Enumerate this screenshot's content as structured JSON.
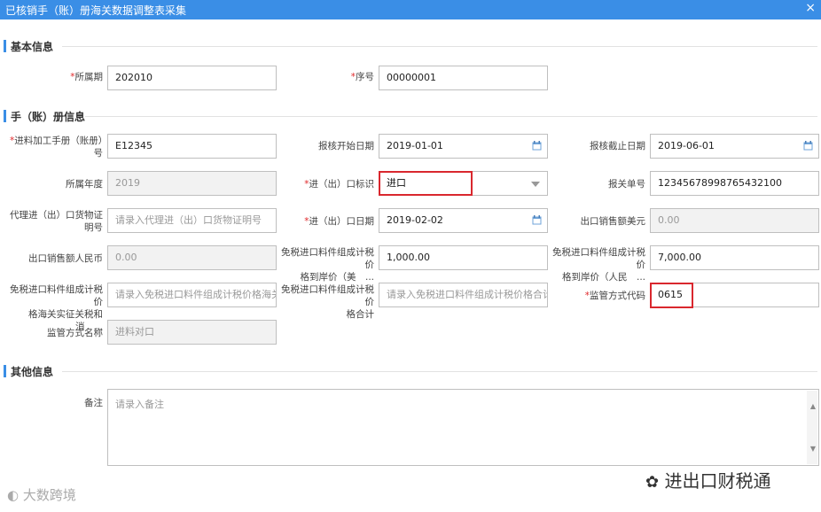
{
  "window": {
    "title": "已核销手（账）册海关数据调整表采集",
    "close": "×"
  },
  "sections": {
    "basic": "基本信息",
    "manual": "手（账）册信息",
    "other": "其他信息"
  },
  "fields": {
    "period": {
      "label": "所属期",
      "value": "202010"
    },
    "seq": {
      "label": "序号",
      "value": "00000001"
    },
    "manual_no": {
      "label": "进料加工手册（账册）号",
      "value": "E12345"
    },
    "start_date": {
      "label": "报核开始日期",
      "value": "2019-01-01"
    },
    "end_date": {
      "label": "报核截止日期",
      "value": "2019-06-01"
    },
    "year": {
      "label": "所属年度",
      "value": "2019"
    },
    "ie_flag": {
      "label": "进（出）口标识",
      "value": "进口"
    },
    "decl_no": {
      "label": "报关单号",
      "value": "12345678998765432100"
    },
    "agent_cert": {
      "label": "代理进（出）口货物证明号",
      "placeholder": "请录入代理进（出）口货物证明号"
    },
    "ie_date": {
      "label": "进（出）口日期",
      "value": "2019-02-02"
    },
    "export_usd": {
      "label": "出口销售额美元",
      "value": "0.00"
    },
    "export_rmb": {
      "label": "出口销售额人民币",
      "value": "0.00"
    },
    "dutyfree_usd": {
      "label1": "免税进口料件组成计税价",
      "label2": "格到岸价（美　...",
      "value": "1,000.00"
    },
    "dutyfree_rmb": {
      "label1": "免税进口料件组成计税价",
      "label2": "格到岸价（人民　...",
      "value": "7,000.00"
    },
    "dutyfree_tax": {
      "label1": "免税进口料件组成计税价",
      "label2": "格海关实征关税和消　...",
      "placeholder": "请录入免税进口料件组成计税价格海关实征关税"
    },
    "dutyfree_total": {
      "label1": "免税进口料件组成计税价",
      "label2": "格合计",
      "placeholder": "请录入免税进口料件组成计税价格合计"
    },
    "sup_code": {
      "label": "监管方式代码",
      "value": "0615"
    },
    "sup_name": {
      "label": "监管方式名称",
      "value": "进料对口"
    },
    "remark": {
      "label": "备注",
      "placeholder": "请录入备注"
    }
  },
  "watermarks": {
    "left": "大数跨境",
    "right": "进出口财税通"
  }
}
